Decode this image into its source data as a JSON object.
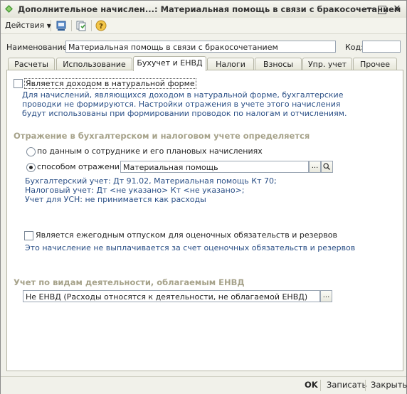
{
  "window": {
    "title": "Дополнительное начислен...: Материальная помощь в связи с бракосочетанием"
  },
  "toolbar": {
    "actions_label": "Действия"
  },
  "header": {
    "name_label": "Наименование:",
    "name_value": "Материальная помощь в связи с бракосочетанием",
    "code_label": "Код:",
    "code_value": ""
  },
  "tabs": [
    {
      "label": "Расчеты"
    },
    {
      "label": "Использование"
    },
    {
      "label": "Бухучет и ЕНВД"
    },
    {
      "label": "Налоги"
    },
    {
      "label": "Взносы"
    },
    {
      "label": "Упр. учет"
    },
    {
      "label": "Прочее"
    }
  ],
  "active_tab": "Бухучет и ЕНВД",
  "natural": {
    "checkbox_label": "Является доходом в натуральной форме",
    "checked": false,
    "info": "Для начислений, являющихся доходом в натуральной форме, бухгалтерские проводки не формируются. Настройки отражения в учете этого начисления будут использованы при формировании проводок по налогам и отчислениям."
  },
  "reflection": {
    "section_title": "Отражение в бухгалтерском и налоговом учете определяется",
    "option1_label": "по данным о сотруднике и его плановых начислениях",
    "option2_label": "способом отражения:",
    "selected_option": 2,
    "method_value": "Материальная помощь",
    "account_line1": "Бухгалтерский учет: Дт 91.02, Материальная помощь Кт 70;",
    "account_line2": "Налоговый учет: Дт <не указано> Кт <не указано>;",
    "account_line3": "Учет для УСН: не принимается как расходы"
  },
  "vacation": {
    "checkbox_label": "Является ежегодным отпуском для оценочных обязательств и резервов",
    "checked": false,
    "info": "Это начисление не выплачивается за счет оценочных обязательств и резервов"
  },
  "envd": {
    "section_title": "Учет по видам деятельности, облагаемым ЕНВД",
    "value": "Не ЕНВД (Расходы относятся к деятельности, не облагаемой ЕНВД)"
  },
  "bottom": {
    "ok_label": "OK",
    "save_label": "Записать",
    "close_label": "Закрыть"
  },
  "colors": {
    "info_text": "#2a4f86",
    "section_title": "#a6a28a",
    "window_bg": "#f1f1ea"
  }
}
